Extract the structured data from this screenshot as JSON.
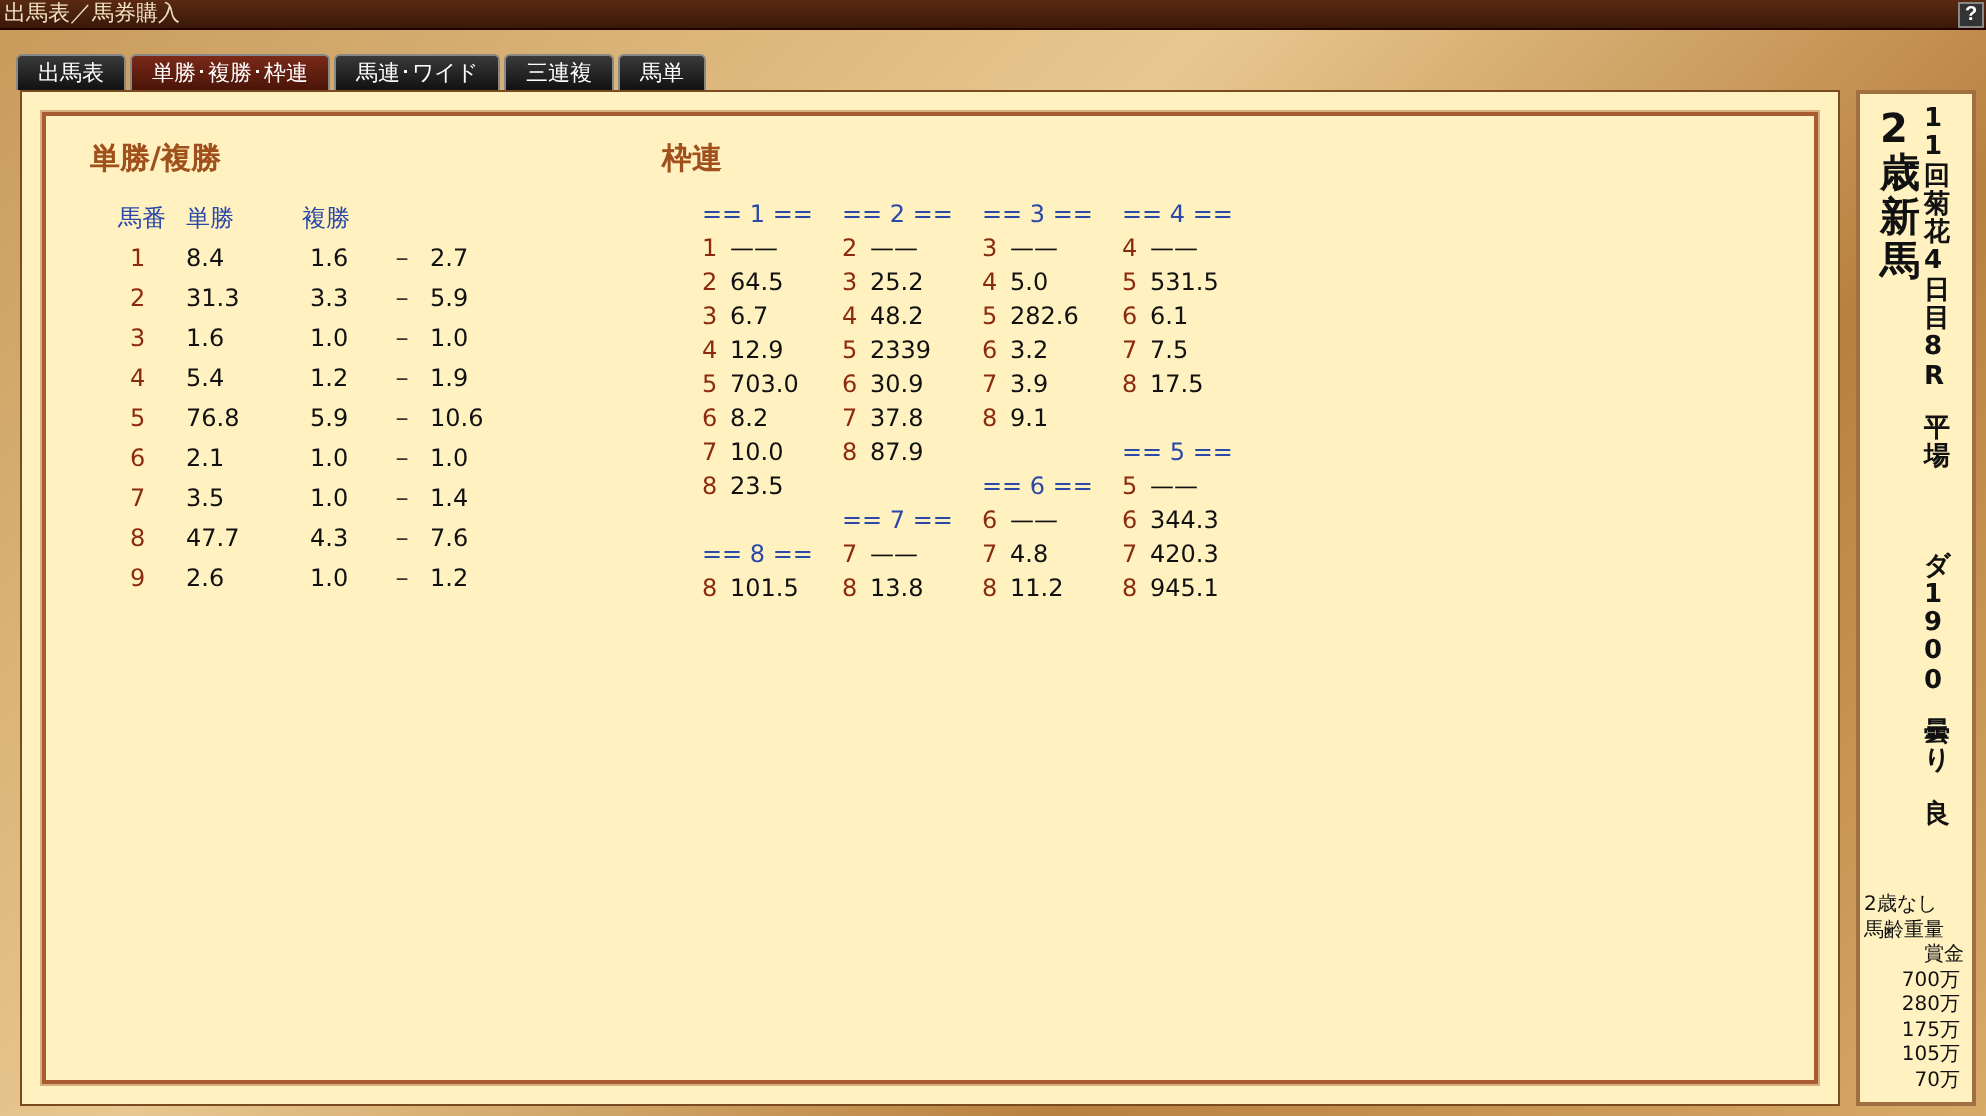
{
  "window": {
    "title": "出馬表／馬券購入",
    "help": "?"
  },
  "tabs": [
    {
      "label": "出馬表",
      "selected": false
    },
    {
      "label": "単勝･複勝･枠連",
      "selected": true
    },
    {
      "label": "馬連･ワイド",
      "selected": false
    },
    {
      "label": "三連複",
      "selected": false
    },
    {
      "label": "馬単",
      "selected": false
    }
  ],
  "win_place": {
    "title": "単勝/複勝",
    "columns": [
      "馬番",
      "単勝",
      "複勝"
    ],
    "rows": [
      {
        "num": "1",
        "win": "8.4",
        "place_low": "1.6",
        "sep": "－",
        "place_high": "2.7"
      },
      {
        "num": "2",
        "win": "31.3",
        "place_low": "3.3",
        "sep": "－",
        "place_high": "5.9"
      },
      {
        "num": "3",
        "win": "1.6",
        "place_low": "1.0",
        "sep": "－",
        "place_high": "1.0"
      },
      {
        "num": "4",
        "win": "5.4",
        "place_low": "1.2",
        "sep": "－",
        "place_high": "1.9"
      },
      {
        "num": "5",
        "win": "76.8",
        "place_low": "5.9",
        "sep": "－",
        "place_high": "10.6"
      },
      {
        "num": "6",
        "win": "2.1",
        "place_low": "1.0",
        "sep": "－",
        "place_high": "1.0"
      },
      {
        "num": "7",
        "win": "3.5",
        "place_low": "1.0",
        "sep": "－",
        "place_high": "1.4"
      },
      {
        "num": "8",
        "win": "47.7",
        "place_low": "4.3",
        "sep": "－",
        "place_high": "7.6"
      },
      {
        "num": "9",
        "win": "2.6",
        "place_low": "1.0",
        "sep": "－",
        "place_high": "1.2"
      }
    ]
  },
  "bracket": {
    "title": "枠連",
    "columns": [
      {
        "groups": [
          {
            "header": "== 1 ==",
            "rows": [
              {
                "num": "1",
                "odds": "——"
              },
              {
                "num": "2",
                "odds": "64.5"
              },
              {
                "num": "3",
                "odds": "6.7"
              },
              {
                "num": "4",
                "odds": "12.9"
              },
              {
                "num": "5",
                "odds": "703.0"
              },
              {
                "num": "6",
                "odds": "8.2"
              },
              {
                "num": "7",
                "odds": "10.0"
              },
              {
                "num": "8",
                "odds": "23.5"
              }
            ]
          },
          {
            "header": "== 8 ==",
            "rows": [
              {
                "num": "8",
                "odds": "101.5"
              }
            ]
          }
        ]
      },
      {
        "groups": [
          {
            "header": "== 2 ==",
            "rows": [
              {
                "num": "2",
                "odds": "——"
              },
              {
                "num": "3",
                "odds": "25.2"
              },
              {
                "num": "4",
                "odds": "48.2"
              },
              {
                "num": "5",
                "odds": "2339"
              },
              {
                "num": "6",
                "odds": "30.9"
              },
              {
                "num": "7",
                "odds": "37.8"
              },
              {
                "num": "8",
                "odds": "87.9"
              }
            ]
          },
          {
            "header": "== 7 ==",
            "rows": [
              {
                "num": "7",
                "odds": "——"
              },
              {
                "num": "8",
                "odds": "13.8"
              }
            ]
          }
        ]
      },
      {
        "groups": [
          {
            "header": "== 3 ==",
            "rows": [
              {
                "num": "3",
                "odds": "——"
              },
              {
                "num": "4",
                "odds": "5.0"
              },
              {
                "num": "5",
                "odds": "282.6"
              },
              {
                "num": "6",
                "odds": "3.2"
              },
              {
                "num": "7",
                "odds": "3.9"
              },
              {
                "num": "8",
                "odds": "9.1"
              }
            ]
          },
          {
            "header": "== 6 ==",
            "rows": [
              {
                "num": "6",
                "odds": "——"
              },
              {
                "num": "7",
                "odds": "4.8"
              },
              {
                "num": "8",
                "odds": "11.2"
              }
            ]
          }
        ]
      },
      {
        "groups": [
          {
            "header": "== 4 ==",
            "rows": [
              {
                "num": "4",
                "odds": "——"
              },
              {
                "num": "5",
                "odds": "531.5"
              },
              {
                "num": "6",
                "odds": "6.1"
              },
              {
                "num": "7",
                "odds": "7.5"
              },
              {
                "num": "8",
                "odds": "17.5"
              }
            ]
          },
          {
            "header": "== 5 ==",
            "rows": [
              {
                "num": "5",
                "odds": "——"
              },
              {
                "num": "6",
                "odds": "344.3"
              },
              {
                "num": "7",
                "odds": "420.3"
              },
              {
                "num": "8",
                "odds": "945.1"
              }
            ]
          }
        ]
      }
    ]
  },
  "race": {
    "class": "2歳新馬",
    "info_groups": [
      [
        "11回菊花4日目8R",
        "平場"
      ],
      [
        "ダ1900",
        "曇り",
        "良"
      ]
    ],
    "conditions": [
      "2歳なし",
      "馬齢重量"
    ],
    "prize_label": "賞金",
    "prizes": [
      "700万",
      "280万",
      "175万",
      "105万",
      "70万"
    ]
  }
}
